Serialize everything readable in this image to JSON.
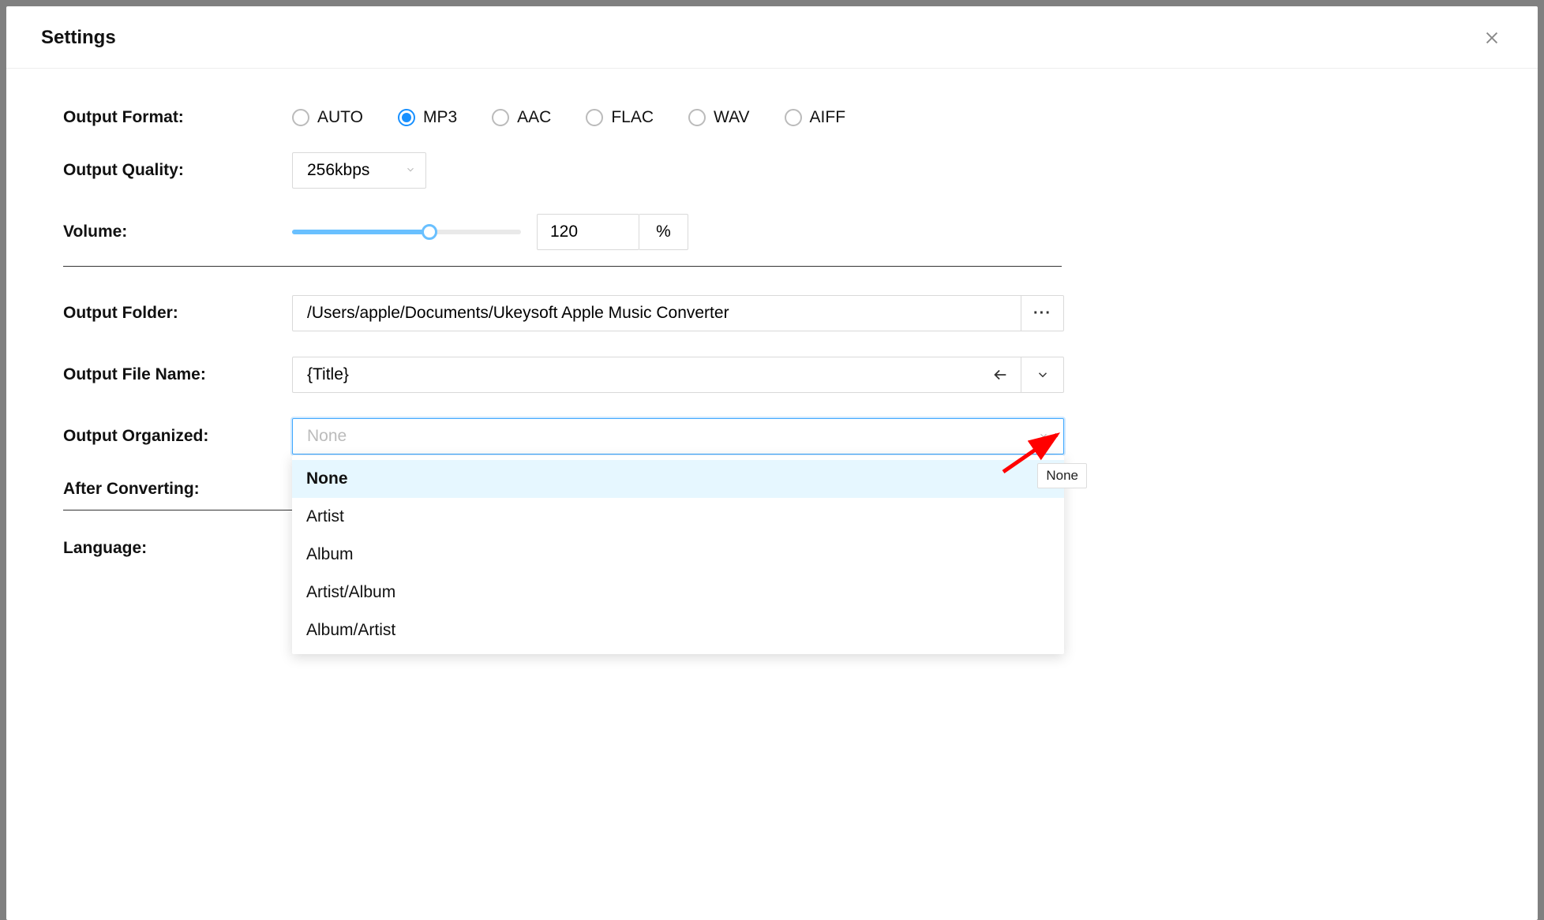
{
  "modal": {
    "title": "Settings",
    "tooltip": "None"
  },
  "labels": {
    "output_format": "Output Format:",
    "output_quality": "Output Quality:",
    "volume": "Volume:",
    "output_folder": "Output Folder:",
    "output_file_name": "Output File Name:",
    "output_organized": "Output Organized:",
    "after_converting": "After Converting:",
    "language": "Language:"
  },
  "output_format": {
    "options": [
      "AUTO",
      "MP3",
      "AAC",
      "FLAC",
      "WAV",
      "AIFF"
    ],
    "selected": "MP3"
  },
  "output_quality": {
    "selected": "256kbps"
  },
  "volume": {
    "value": "120",
    "unit": "%"
  },
  "output_folder": {
    "value": "/Users/apple/Documents/Ukeysoft Apple Music Converter"
  },
  "output_file_name": {
    "value": "{Title}"
  },
  "output_organized": {
    "placeholder": "None",
    "options": [
      "None",
      "Artist",
      "Album",
      "Artist/Album",
      "Album/Artist"
    ],
    "selected": "None"
  }
}
